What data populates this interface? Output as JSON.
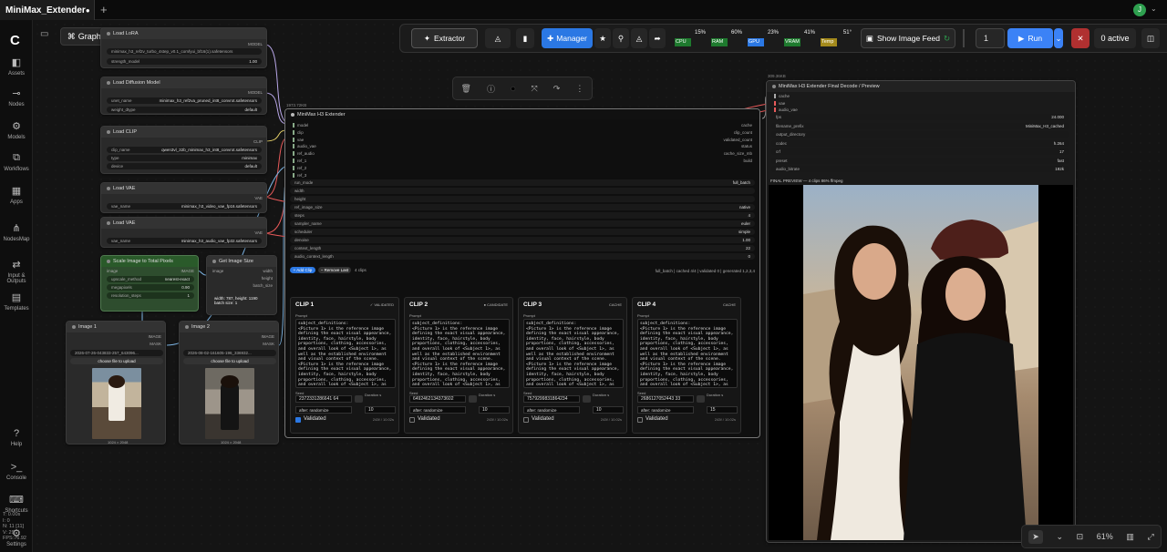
{
  "tab": {
    "title": "MiniMax_Extender",
    "dot": "●",
    "plus": "+",
    "avatar": "J"
  },
  "sidebar": [
    {
      "icon": "◧",
      "label": "Assets"
    },
    {
      "icon": "⊸",
      "label": "Nodes"
    },
    {
      "icon": "⚙",
      "label": "Models"
    },
    {
      "icon": "⧉",
      "label": "Workflows"
    },
    {
      "icon": "▦",
      "label": "Apps"
    },
    {
      "icon": "⋔",
      "label": "NodesMap"
    },
    {
      "icon": "⇄",
      "label": "Input & Outputs"
    },
    {
      "icon": "▤",
      "label": "Templates"
    },
    {
      "icon": "?",
      "label": "Help"
    },
    {
      "icon": ">_",
      "label": "Console"
    },
    {
      "icon": "⌨",
      "label": "Shortcuts"
    },
    {
      "icon": "⚙",
      "label": "Settings"
    }
  ],
  "stats": {
    "t": "T: 0.00s",
    "i": "I: 0",
    "n": "N: 11 [11]",
    "v": "V: 29",
    "fps": "FPS:76.92"
  },
  "graph_btn": "Graph",
  "toolbar": {
    "extractor": "Extractor",
    "manager": "Manager",
    "meters": [
      {
        "label": "CPU",
        "value": "15%"
      },
      {
        "label": "RAM",
        "value": "60%"
      },
      {
        "label": "GPU",
        "value": "23%"
      },
      {
        "label": "VRAM",
        "value": "41%"
      },
      {
        "label": "Temp",
        "value": "51°"
      }
    ],
    "show_feed": "Show Image Feed",
    "queue_count": "1",
    "run": "Run",
    "active": "0 active"
  },
  "nodes": {
    "lora": {
      "title": "Load LoRA",
      "out": "MODEL",
      "w1": "minimax_h3_ref2v_turbo_4step_v0.1_comfyui_bf16(1).safetensors",
      "w2_label": "strength_model",
      "w2_val": "1.00"
    },
    "diff": {
      "title": "Load Diffusion Model",
      "out": "MODEL",
      "w1_label": "unet_name",
      "w1_val": "minimax_h3_ref2va_pruned_int8_convrot.safetensors",
      "w2_label": "weight_dtype",
      "w2_val": "default"
    },
    "clip": {
      "title": "Load CLIP",
      "out": "CLIP",
      "w1_label": "clip_name",
      "w1_val": "qwen3vl_32b_minimax_h3_int8_convrot.safetensors",
      "w2_label": "type",
      "w2_val": "minimax",
      "w3_label": "device",
      "w3_val": "default"
    },
    "vae1": {
      "title": "Load VAE",
      "out": "VAE",
      "w1_label": "vae_name",
      "w1_val": "minimax_h3_video_vae_fp16.safetensors"
    },
    "vae2": {
      "title": "Load VAE",
      "out": "VAE",
      "w1_label": "vae_name",
      "w1_val": "minimax_h3_audio_vae_fp32.safetensors"
    },
    "scale": {
      "title": "Scale Image to Total Pixels",
      "in": "image",
      "out": "IMAGE",
      "w1_label": "upscale_method",
      "w1_val": "nearest-exact",
      "w2_label": "megapixels",
      "w2_val": "0.90",
      "w3_label": "resolution_steps",
      "w3_val": "1"
    },
    "size": {
      "title": "Get Image Size",
      "in": "image",
      "o1": "width",
      "o2": "height",
      "o3": "batch_size",
      "info": "width: 787, height: 1190\nbatch size: 1"
    },
    "img1": {
      "title": "Image 1",
      "o1": "IMAGE",
      "o2": "MASK",
      "file": "2026-07-26-043833-257_643096...",
      "upload": "choose file to upload",
      "dims": "1024 × 2048"
    },
    "img2": {
      "title": "Image 2",
      "o1": "IMAGE",
      "o2": "MASK",
      "file": "2026-08-02-161605-196_336932...",
      "upload": "choose file to upload",
      "dims": "1024 × 2048"
    }
  },
  "ext": {
    "badge": "1973.72KB",
    "title": "MiniMax H3 Extender",
    "inputs": [
      "model",
      "clip",
      "vae",
      "audio_vae",
      "ref_audio",
      "ref_1",
      "ref_2",
      "ref_3"
    ],
    "outputs": [
      "cache",
      "clip_count",
      "validated_count",
      "status",
      "cache_size_mb",
      "build"
    ],
    "widgets": [
      {
        "label": "run_mode",
        "val": "full_batch"
      },
      {
        "label": "width",
        "val": ""
      },
      {
        "label": "height",
        "val": ""
      },
      {
        "label": "ref_image_size",
        "val": "native"
      },
      {
        "label": "steps",
        "val": "4"
      },
      {
        "label": "sampler_name",
        "val": "euler"
      },
      {
        "label": "scheduler",
        "val": "simple"
      },
      {
        "label": "denoise",
        "val": "1.00"
      },
      {
        "label": "context_length",
        "val": "22"
      },
      {
        "label": "audio_context_length",
        "val": "0"
      }
    ],
    "add_clip": "+ Add Clip",
    "remove_last": "− Remove Last",
    "clip_count": "4 clips",
    "status": "full_batch | cached 4/4 | validated 0 | generated 1,2,3,4",
    "prompt_label": "Prompt",
    "seed_label": "Seed",
    "duration_label": "Duration s",
    "after_label": "after: randomize",
    "validated_label": "Validated",
    "prompt_text": "subject_definitions:\n<Picture 1> is the reference image defining the exact visual appearance, identity, face, hairstyle, body proportions, clothing, accessories, and overall look of <Subject 1>, as well as the established environment and visual context of the scene.\n<Picture 1> is the reference image defining the exact visual appearance, identity, face, hairstyle, body proportions, clothing, accessories, and overall look of <Subject 1>, as well as the established environment",
    "clips": [
      {
        "title": "CLIP 1",
        "status": "✓ VALIDATED",
        "seed": "2372331286641 64",
        "dur": "10",
        "foot": "243f / 10.02s",
        "checked": true
      },
      {
        "title": "CLIP 2",
        "status": "● CANDIDATE",
        "seed": "6492462134373602",
        "dur": "10",
        "foot": "243f / 10.02s",
        "checked": false
      },
      {
        "title": "CLIP 3",
        "status": "CACHE",
        "seed": "7579299831864234",
        "dur": "10",
        "foot": "243f / 10.02s",
        "checked": false
      },
      {
        "title": "CLIP 4",
        "status": "CACHE",
        "seed": "2686127052443 33",
        "dur": "15",
        "foot": "243f / 10.02s",
        "checked": false
      }
    ]
  },
  "final": {
    "badge": "309.36KB",
    "title": "MiniMax H3 Extender Final Decode / Preview",
    "inputs": [
      "cache",
      "vae",
      "audio_vae"
    ],
    "widgets": [
      {
        "label": "fps",
        "val": "24.000"
      },
      {
        "label": "filename_prefix",
        "val": "MiniMax_H3_cached"
      },
      {
        "label": "output_directory",
        "val": ""
      },
      {
        "label": "codec",
        "val": "h.264"
      },
      {
        "label": "crf",
        "val": "17"
      },
      {
        "label": "preset",
        "val": "fast"
      },
      {
        "label": "audio_bitrate",
        "val": "192k"
      }
    ],
    "preview_label": "FINAL PREVIEW — 4 clips 86% ffmpeg"
  },
  "bottom": {
    "zoom": "61%"
  },
  "colors": {
    "accent": "#2b78e4",
    "green_node": "#2e4d2e",
    "run": "#3b82f6",
    "stop": "#b03030"
  }
}
